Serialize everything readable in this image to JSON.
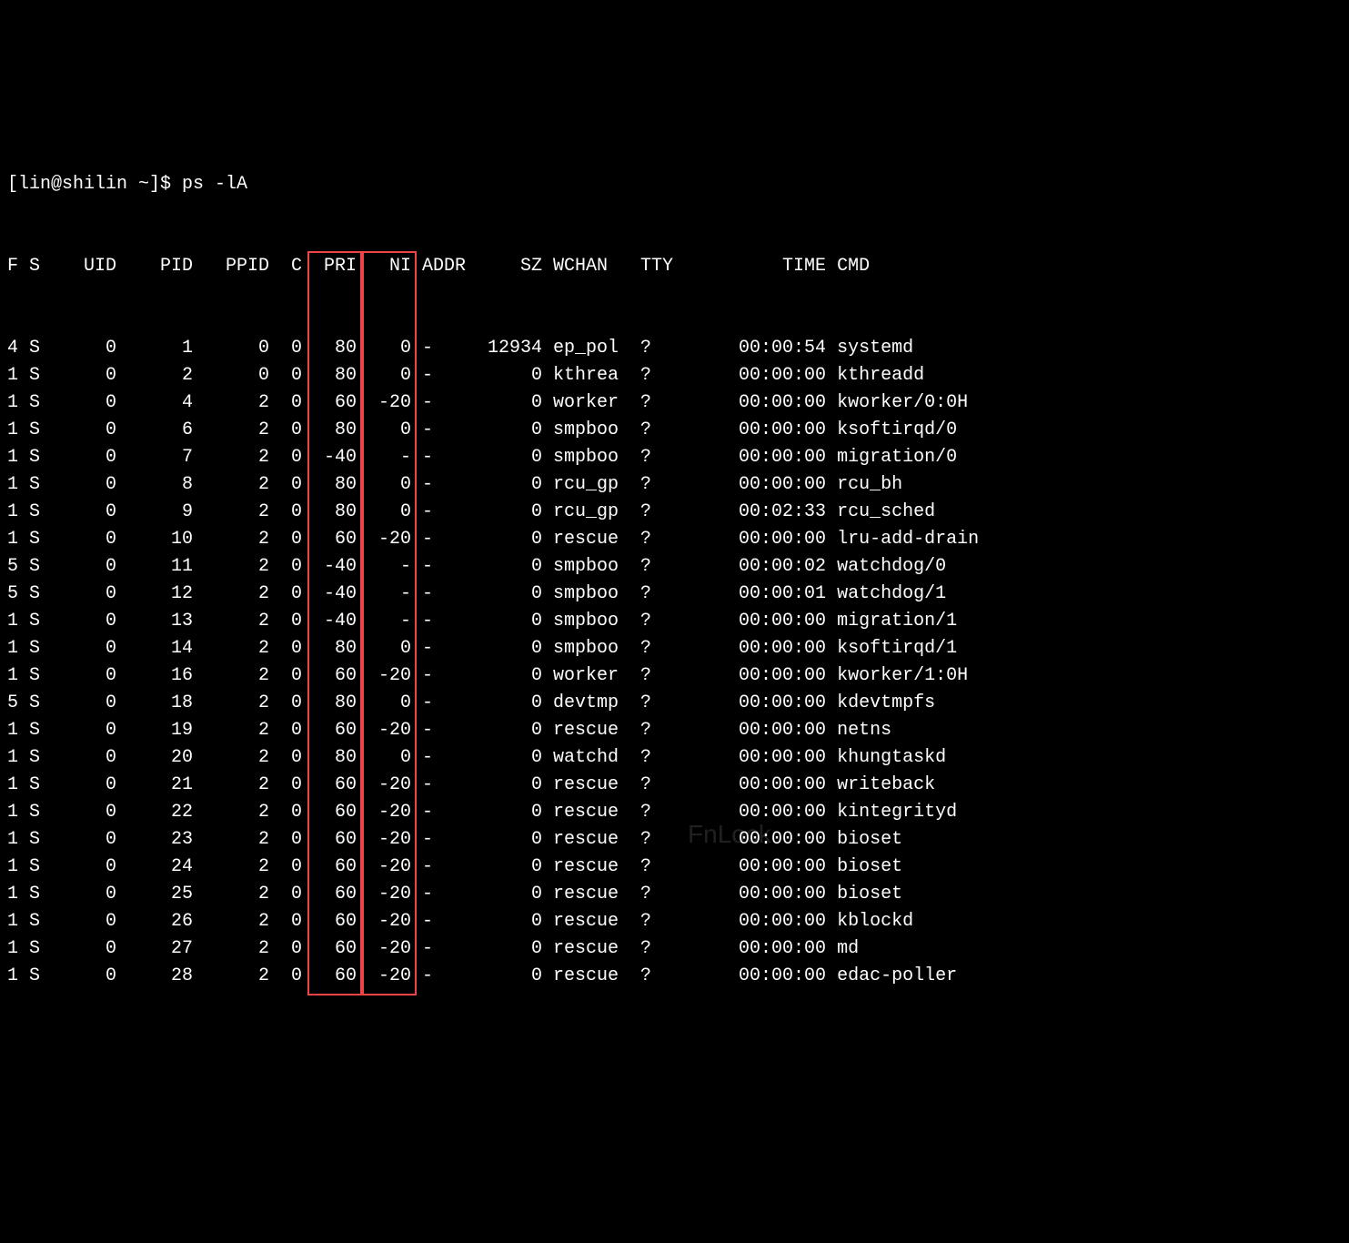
{
  "prompt": "[lin@shilin ~]$ ps -lA",
  "headers": {
    "F": "F",
    "S": "S",
    "UID": "UID",
    "PID": "PID",
    "PPID": "PPID",
    "C": "C",
    "PRI": "PRI",
    "NI": "NI",
    "ADDR": "ADDR",
    "SZ": "SZ",
    "WCHAN": "WCHAN",
    "TTY": "TTY",
    "TIME": "TIME",
    "CMD": "CMD"
  },
  "rows": [
    {
      "F": "4",
      "S": "S",
      "UID": "0",
      "PID": "1",
      "PPID": "0",
      "C": "0",
      "PRI": "80",
      "NI": "0",
      "ADDR": "-",
      "SZ": "12934",
      "WCHAN": "ep_pol",
      "TTY": "?",
      "TIME": "00:00:54",
      "CMD": "systemd"
    },
    {
      "F": "1",
      "S": "S",
      "UID": "0",
      "PID": "2",
      "PPID": "0",
      "C": "0",
      "PRI": "80",
      "NI": "0",
      "ADDR": "-",
      "SZ": "0",
      "WCHAN": "kthrea",
      "TTY": "?",
      "TIME": "00:00:00",
      "CMD": "kthreadd"
    },
    {
      "F": "1",
      "S": "S",
      "UID": "0",
      "PID": "4",
      "PPID": "2",
      "C": "0",
      "PRI": "60",
      "NI": "-20",
      "ADDR": "-",
      "SZ": "0",
      "WCHAN": "worker",
      "TTY": "?",
      "TIME": "00:00:00",
      "CMD": "kworker/0:0H"
    },
    {
      "F": "1",
      "S": "S",
      "UID": "0",
      "PID": "6",
      "PPID": "2",
      "C": "0",
      "PRI": "80",
      "NI": "0",
      "ADDR": "-",
      "SZ": "0",
      "WCHAN": "smpboo",
      "TTY": "?",
      "TIME": "00:00:00",
      "CMD": "ksoftirqd/0"
    },
    {
      "F": "1",
      "S": "S",
      "UID": "0",
      "PID": "7",
      "PPID": "2",
      "C": "0",
      "PRI": "-40",
      "NI": "-",
      "ADDR": "-",
      "SZ": "0",
      "WCHAN": "smpboo",
      "TTY": "?",
      "TIME": "00:00:00",
      "CMD": "migration/0"
    },
    {
      "F": "1",
      "S": "S",
      "UID": "0",
      "PID": "8",
      "PPID": "2",
      "C": "0",
      "PRI": "80",
      "NI": "0",
      "ADDR": "-",
      "SZ": "0",
      "WCHAN": "rcu_gp",
      "TTY": "?",
      "TIME": "00:00:00",
      "CMD": "rcu_bh"
    },
    {
      "F": "1",
      "S": "S",
      "UID": "0",
      "PID": "9",
      "PPID": "2",
      "C": "0",
      "PRI": "80",
      "NI": "0",
      "ADDR": "-",
      "SZ": "0",
      "WCHAN": "rcu_gp",
      "TTY": "?",
      "TIME": "00:02:33",
      "CMD": "rcu_sched"
    },
    {
      "F": "1",
      "S": "S",
      "UID": "0",
      "PID": "10",
      "PPID": "2",
      "C": "0",
      "PRI": "60",
      "NI": "-20",
      "ADDR": "-",
      "SZ": "0",
      "WCHAN": "rescue",
      "TTY": "?",
      "TIME": "00:00:00",
      "CMD": "lru-add-drain"
    },
    {
      "F": "5",
      "S": "S",
      "UID": "0",
      "PID": "11",
      "PPID": "2",
      "C": "0",
      "PRI": "-40",
      "NI": "-",
      "ADDR": "-",
      "SZ": "0",
      "WCHAN": "smpboo",
      "TTY": "?",
      "TIME": "00:00:02",
      "CMD": "watchdog/0"
    },
    {
      "F": "5",
      "S": "S",
      "UID": "0",
      "PID": "12",
      "PPID": "2",
      "C": "0",
      "PRI": "-40",
      "NI": "-",
      "ADDR": "-",
      "SZ": "0",
      "WCHAN": "smpboo",
      "TTY": "?",
      "TIME": "00:00:01",
      "CMD": "watchdog/1"
    },
    {
      "F": "1",
      "S": "S",
      "UID": "0",
      "PID": "13",
      "PPID": "2",
      "C": "0",
      "PRI": "-40",
      "NI": "-",
      "ADDR": "-",
      "SZ": "0",
      "WCHAN": "smpboo",
      "TTY": "?",
      "TIME": "00:00:00",
      "CMD": "migration/1"
    },
    {
      "F": "1",
      "S": "S",
      "UID": "0",
      "PID": "14",
      "PPID": "2",
      "C": "0",
      "PRI": "80",
      "NI": "0",
      "ADDR": "-",
      "SZ": "0",
      "WCHAN": "smpboo",
      "TTY": "?",
      "TIME": "00:00:00",
      "CMD": "ksoftirqd/1"
    },
    {
      "F": "1",
      "S": "S",
      "UID": "0",
      "PID": "16",
      "PPID": "2",
      "C": "0",
      "PRI": "60",
      "NI": "-20",
      "ADDR": "-",
      "SZ": "0",
      "WCHAN": "worker",
      "TTY": "?",
      "TIME": "00:00:00",
      "CMD": "kworker/1:0H"
    },
    {
      "F": "5",
      "S": "S",
      "UID": "0",
      "PID": "18",
      "PPID": "2",
      "C": "0",
      "PRI": "80",
      "NI": "0",
      "ADDR": "-",
      "SZ": "0",
      "WCHAN": "devtmp",
      "TTY": "?",
      "TIME": "00:00:00",
      "CMD": "kdevtmpfs"
    },
    {
      "F": "1",
      "S": "S",
      "UID": "0",
      "PID": "19",
      "PPID": "2",
      "C": "0",
      "PRI": "60",
      "NI": "-20",
      "ADDR": "-",
      "SZ": "0",
      "WCHAN": "rescue",
      "TTY": "?",
      "TIME": "00:00:00",
      "CMD": "netns"
    },
    {
      "F": "1",
      "S": "S",
      "UID": "0",
      "PID": "20",
      "PPID": "2",
      "C": "0",
      "PRI": "80",
      "NI": "0",
      "ADDR": "-",
      "SZ": "0",
      "WCHAN": "watchd",
      "TTY": "?",
      "TIME": "00:00:00",
      "CMD": "khungtaskd"
    },
    {
      "F": "1",
      "S": "S",
      "UID": "0",
      "PID": "21",
      "PPID": "2",
      "C": "0",
      "PRI": "60",
      "NI": "-20",
      "ADDR": "-",
      "SZ": "0",
      "WCHAN": "rescue",
      "TTY": "?",
      "TIME": "00:00:00",
      "CMD": "writeback"
    },
    {
      "F": "1",
      "S": "S",
      "UID": "0",
      "PID": "22",
      "PPID": "2",
      "C": "0",
      "PRI": "60",
      "NI": "-20",
      "ADDR": "-",
      "SZ": "0",
      "WCHAN": "rescue",
      "TTY": "?",
      "TIME": "00:00:00",
      "CMD": "kintegrityd"
    },
    {
      "F": "1",
      "S": "S",
      "UID": "0",
      "PID": "23",
      "PPID": "2",
      "C": "0",
      "PRI": "60",
      "NI": "-20",
      "ADDR": "-",
      "SZ": "0",
      "WCHAN": "rescue",
      "TTY": "?",
      "TIME": "00:00:00",
      "CMD": "bioset"
    },
    {
      "F": "1",
      "S": "S",
      "UID": "0",
      "PID": "24",
      "PPID": "2",
      "C": "0",
      "PRI": "60",
      "NI": "-20",
      "ADDR": "-",
      "SZ": "0",
      "WCHAN": "rescue",
      "TTY": "?",
      "TIME": "00:00:00",
      "CMD": "bioset"
    },
    {
      "F": "1",
      "S": "S",
      "UID": "0",
      "PID": "25",
      "PPID": "2",
      "C": "0",
      "PRI": "60",
      "NI": "-20",
      "ADDR": "-",
      "SZ": "0",
      "WCHAN": "rescue",
      "TTY": "?",
      "TIME": "00:00:00",
      "CMD": "bioset"
    },
    {
      "F": "1",
      "S": "S",
      "UID": "0",
      "PID": "26",
      "PPID": "2",
      "C": "0",
      "PRI": "60",
      "NI": "-20",
      "ADDR": "-",
      "SZ": "0",
      "WCHAN": "rescue",
      "TTY": "?",
      "TIME": "00:00:00",
      "CMD": "kblockd"
    },
    {
      "F": "1",
      "S": "S",
      "UID": "0",
      "PID": "27",
      "PPID": "2",
      "C": "0",
      "PRI": "60",
      "NI": "-20",
      "ADDR": "-",
      "SZ": "0",
      "WCHAN": "rescue",
      "TTY": "?",
      "TIME": "00:00:00",
      "CMD": "md"
    },
    {
      "F": "1",
      "S": "S",
      "UID": "0",
      "PID": "28",
      "PPID": "2",
      "C": "0",
      "PRI": "60",
      "NI": "-20",
      "ADDR": "-",
      "SZ": "0",
      "WCHAN": "rescue",
      "TTY": "?",
      "TIME": "00:00:00",
      "CMD": "edac-poller"
    }
  ],
  "watermark": "FnLock",
  "highlight_color": "#ee4444"
}
